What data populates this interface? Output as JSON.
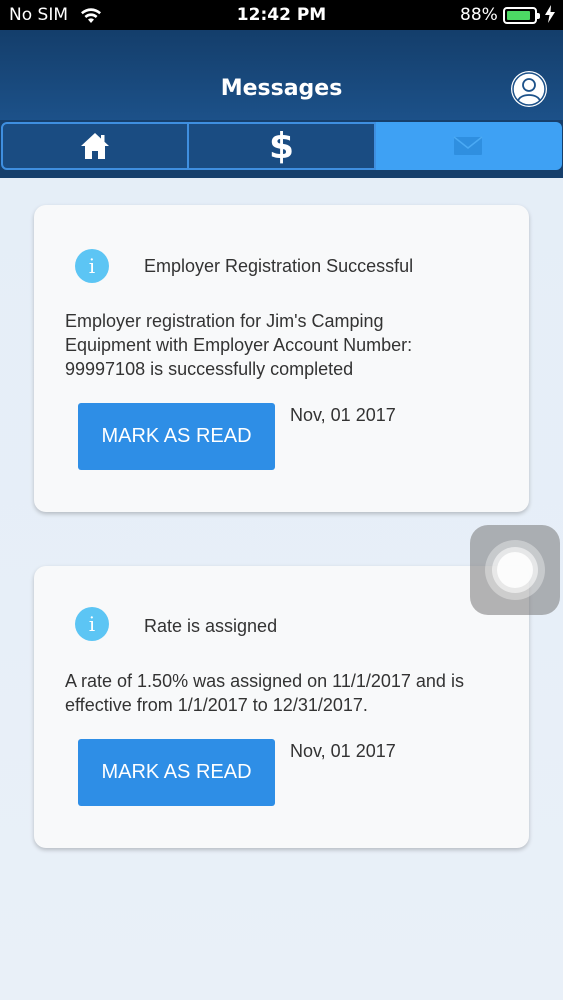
{
  "status_bar": {
    "carrier": "No SIM",
    "time": "12:42 PM",
    "battery_percent": "88%",
    "battery_level": 0.88,
    "wifi_icon": "wifi-icon",
    "charging_icon": "bolt-icon"
  },
  "header": {
    "title": "Messages",
    "profile_icon": "user-circle-icon"
  },
  "tabs": [
    {
      "icon": "home-icon",
      "glyph": "",
      "active": false
    },
    {
      "icon": "dollar-icon",
      "glyph": "$",
      "active": false
    },
    {
      "icon": "envelope-icon",
      "glyph": "",
      "active": true
    }
  ],
  "colors": {
    "header": "#1c5189",
    "tab_active": "#3ea1f4",
    "button": "#2e8ee6",
    "info_icon": "#5cc5f4"
  },
  "messages": [
    {
      "title": "Employer Registration Successful",
      "body_lines": [
        "Employer registration for Jim's Camping",
        "Equipment with Employer Account Number:",
        "99997108 is successfully completed"
      ],
      "button_label": "MARK AS READ",
      "date": "Nov, 01 2017",
      "icon": "info-icon"
    },
    {
      "title": "Rate is assigned",
      "body_lines": [
        "A rate of 1.50% was assigned on 11/1/2017 and is",
        "effective from 1/1/2017 to 12/31/2017."
      ],
      "button_label": "MARK AS READ",
      "date": "Nov, 01 2017",
      "icon": "info-icon"
    }
  ],
  "info_glyph": "i"
}
